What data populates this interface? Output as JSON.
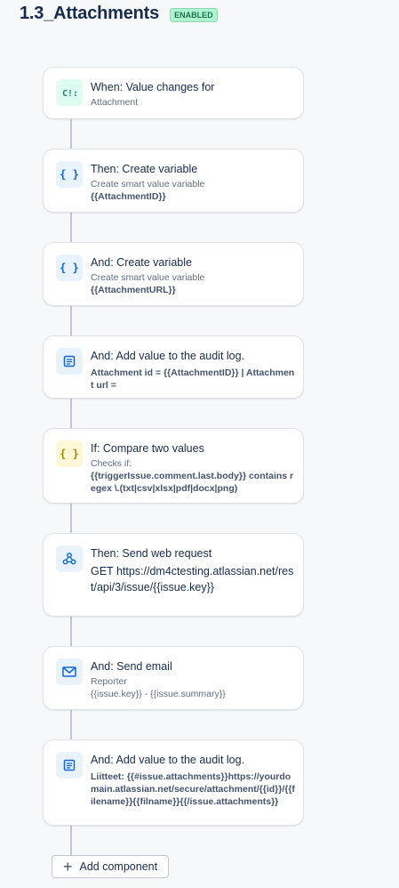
{
  "header": {
    "title": "1.3_Attachments",
    "status": "ENABLED"
  },
  "components": [
    {
      "title": "When: Value changes for",
      "subtitle": "Attachment",
      "icon": "trigger-icon"
    },
    {
      "title": "Then: Create variable",
      "subtitle": "Create smart value variable",
      "detail": "{{AttachmentID}}",
      "icon": "braces-icon"
    },
    {
      "title": "And: Create variable",
      "subtitle": "Create smart value variable",
      "detail": "{{AttachmentURL}}",
      "icon": "braces-icon"
    },
    {
      "title": "And: Add value to the audit log.",
      "detail": "Attachment id = {{AttachmentID}} | Attachment url =",
      "icon": "log-icon"
    },
    {
      "title": "If: Compare two values",
      "subtitle": "Checks if:",
      "detail": "{{triggerIssue.comment.last.body}} contains regex \\.(txt|csv|xlsx|pdf|docx|png)",
      "icon": "condition-braces-icon"
    },
    {
      "title": "Then: Send web request",
      "detail": "GET https://dm4ctesting.atlassian.net/rest/api/3/issue/{{issue.key}}",
      "icon": "webhook-icon"
    },
    {
      "title": "And: Send email",
      "subtitle": "Reporter",
      "detail": "{{issue.key}} - {{issue.summary}}",
      "icon": "email-icon"
    },
    {
      "title": "And: Add value to the audit log.",
      "detail": "Liitteet: {{#issue.attachments}}https://yourdomain.atlassian.net/secure/attachment/{{id}}/{{filename}}{{filname}}{{/issue.attachments}}",
      "icon": "log-icon"
    }
  ],
  "footer": {
    "add_label": "Add component"
  }
}
